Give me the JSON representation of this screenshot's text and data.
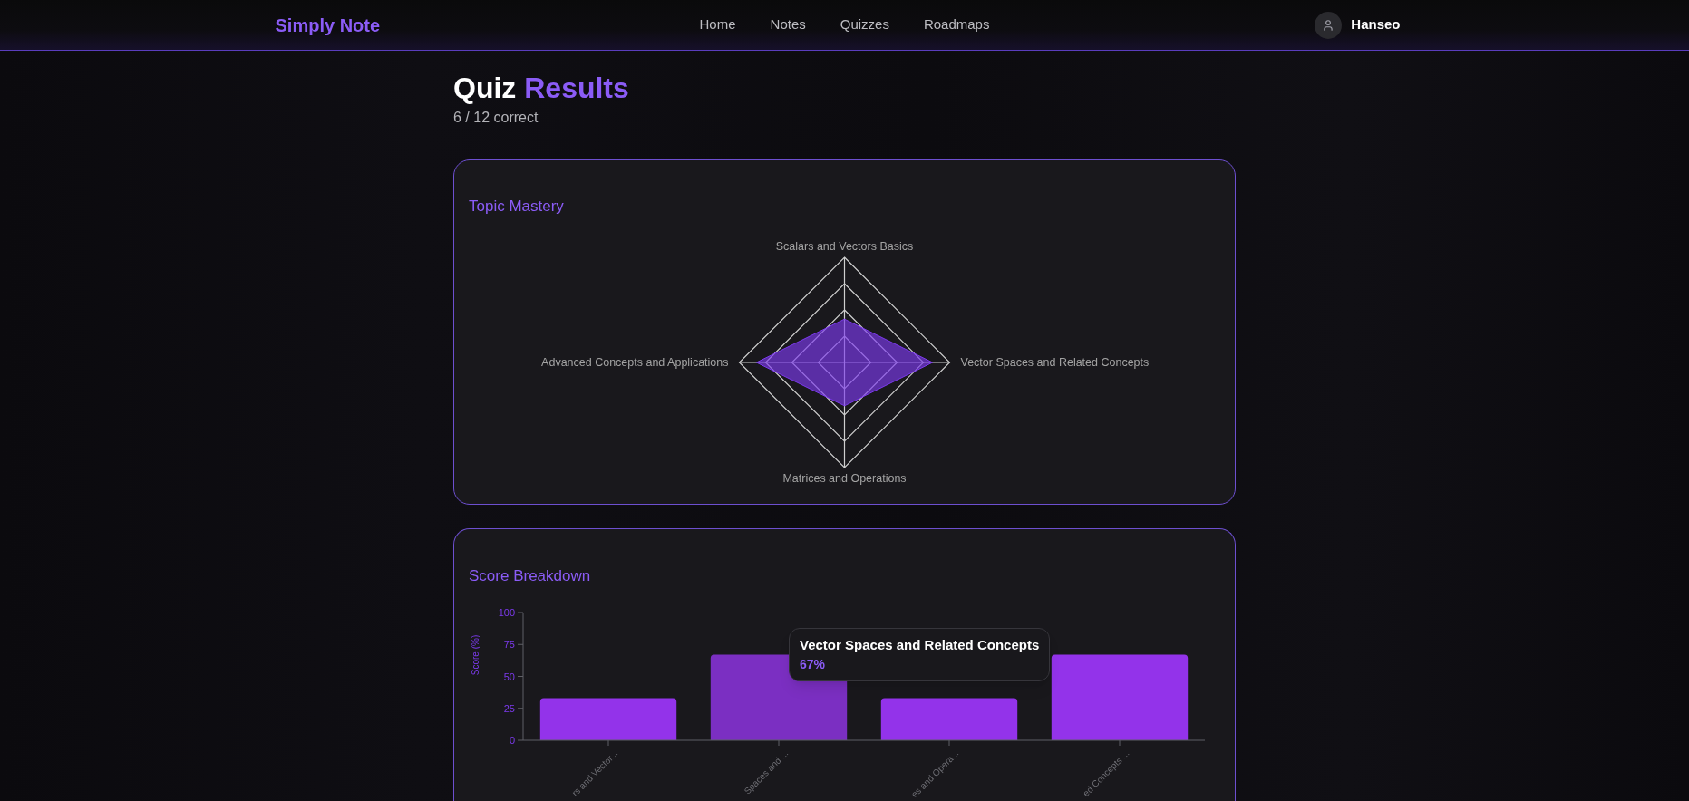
{
  "header": {
    "logo": "Simply Note",
    "nav": [
      {
        "label": "Home"
      },
      {
        "label": "Notes"
      },
      {
        "label": "Quizzes"
      },
      {
        "label": "Roadmaps"
      }
    ],
    "user": {
      "name": "Hanseo"
    }
  },
  "page": {
    "title_lead": "Quiz",
    "title_accent": "Results",
    "subtitle": "6 / 12 correct"
  },
  "topic_mastery": {
    "title": "Topic Mastery",
    "axes": [
      "Scalars and Vectors Basics",
      "Vector Spaces and Related Concepts",
      "Matrices and Operations",
      "Advanced Concepts and Applications"
    ]
  },
  "score_breakdown": {
    "title": "Score Breakdown",
    "chart_data": {
      "type": "bar",
      "ylabel": "Score (%)",
      "categories": [
        "rs and Vector...",
        "Spaces and ...",
        "es and Opera...",
        "ed Concepts ..."
      ],
      "values": [
        33,
        67,
        33,
        67
      ],
      "ylim": [
        0,
        100
      ],
      "yticks": [
        0,
        25,
        50,
        75,
        100
      ]
    },
    "bars": [
      {
        "hovered": false
      },
      {
        "hovered": true
      },
      {
        "hovered": false
      },
      {
        "hovered": false
      }
    ],
    "tooltip": {
      "title": "Vector Spaces and Related Concepts",
      "value": "67%"
    }
  }
}
